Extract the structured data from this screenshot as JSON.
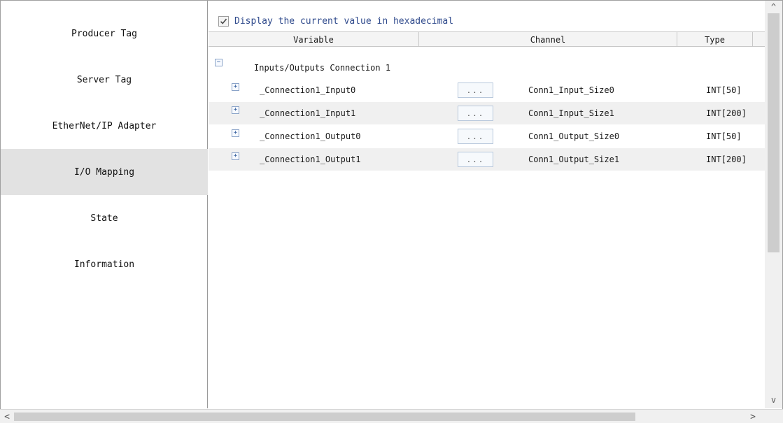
{
  "sidebar": {
    "items": [
      {
        "label": "Producer Tag",
        "selected": false
      },
      {
        "label": "Server Tag",
        "selected": false
      },
      {
        "label": "EtherNet/IP Adapter",
        "selected": false
      },
      {
        "label": "I/O Mapping",
        "selected": true
      },
      {
        "label": "State",
        "selected": false
      },
      {
        "label": "Information",
        "selected": false
      }
    ]
  },
  "main": {
    "hex_checkbox": {
      "label": "Display the current value in hexadecimal",
      "checked": true
    },
    "columns": [
      "Variable",
      "Channel",
      "Type"
    ],
    "group": {
      "label": "Inputs/Outputs Connection 1",
      "expanded": true,
      "toggle_symbol": "−"
    },
    "rows": [
      {
        "variable": "_Connection1_Input0",
        "button": "...",
        "channel": "Conn1_Input_Size0",
        "type": "INT[50]",
        "toggle_symbol": "+"
      },
      {
        "variable": "_Connection1_Input1",
        "button": "...",
        "channel": "Conn1_Input_Size1",
        "type": "INT[200]",
        "toggle_symbol": "+"
      },
      {
        "variable": "_Connection1_Output0",
        "button": "...",
        "channel": "Conn1_Output_Size0",
        "type": "INT[50]",
        "toggle_symbol": "+"
      },
      {
        "variable": "_Connection1_Output1",
        "button": "...",
        "channel": "Conn1_Output_Size1",
        "type": "INT[200]",
        "toggle_symbol": "+"
      }
    ]
  },
  "scrollbars": {
    "up": "^",
    "down": "v",
    "left": "<",
    "right": ">"
  },
  "colors": {
    "selected_nav": "#e2e2e2",
    "alt_row": "#f0f0f0",
    "checkbox_label": "#2f4a8c"
  }
}
